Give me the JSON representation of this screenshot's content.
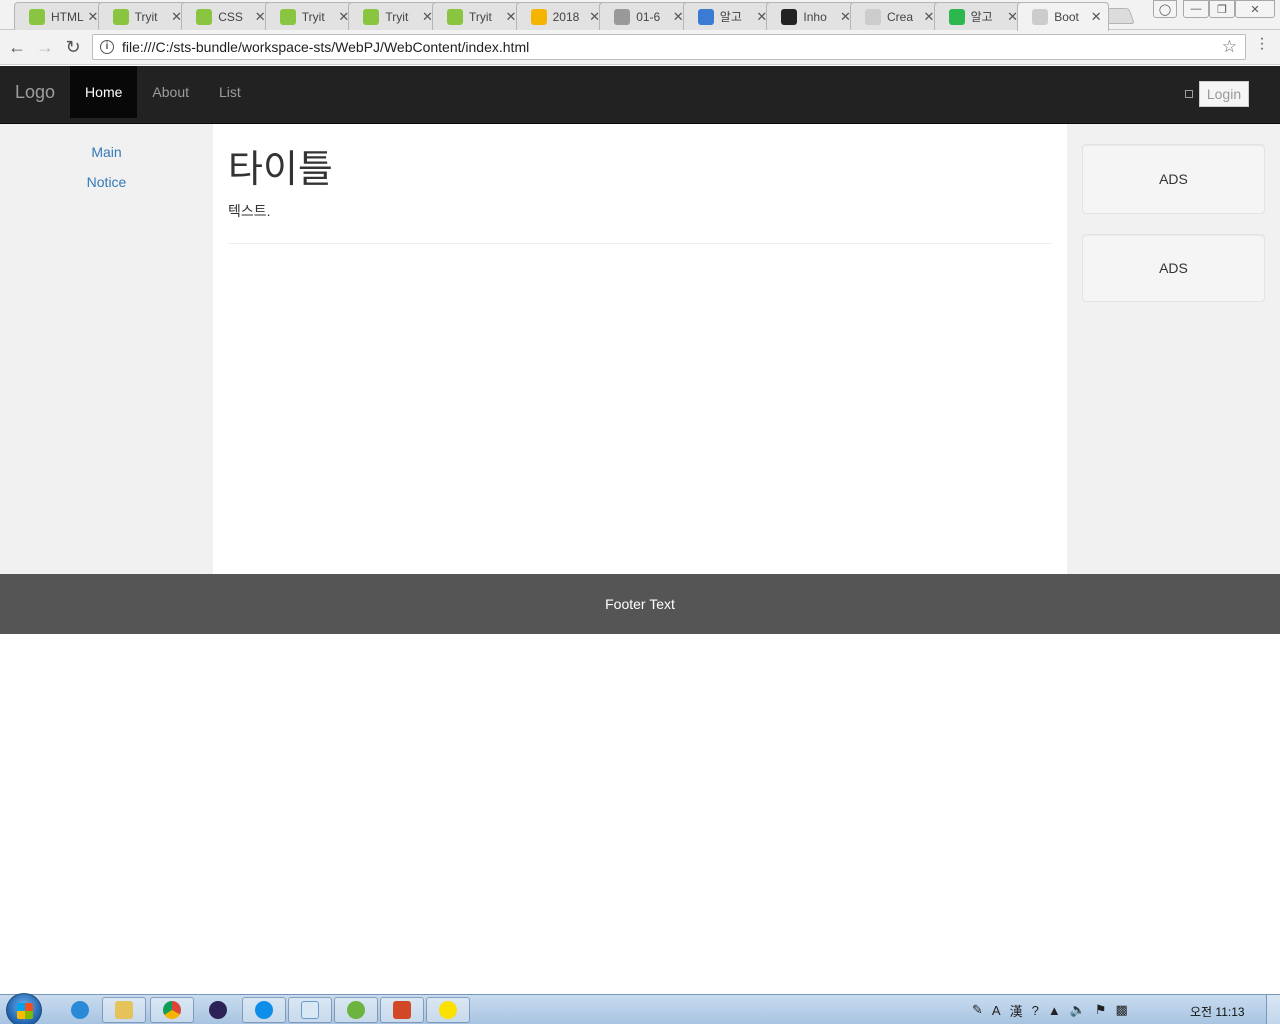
{
  "browser": {
    "tabs": [
      {
        "label": "HTML",
        "favicon": "w3schools-icon",
        "color": "#8ac542"
      },
      {
        "label": "Tryit",
        "favicon": "w3schools-icon",
        "color": "#8ac542"
      },
      {
        "label": "CSS",
        "favicon": "w3schools-icon",
        "color": "#8ac542"
      },
      {
        "label": "Tryit",
        "favicon": "w3schools-icon",
        "color": "#8ac542"
      },
      {
        "label": "Tryit",
        "favicon": "w3schools-icon",
        "color": "#8ac542"
      },
      {
        "label": "Tryit",
        "favicon": "w3schools-icon",
        "color": "#8ac542"
      },
      {
        "label": "2018",
        "favicon": "google-drive-icon",
        "color": "#f4b400"
      },
      {
        "label": "01-6",
        "favicon": "wikidocs-icon",
        "color": "#999999"
      },
      {
        "label": "알고",
        "favicon": "code-icon",
        "color": "#3b7bd4"
      },
      {
        "label": "Inho",
        "favicon": "github-icon",
        "color": "#222222"
      },
      {
        "label": "Crea",
        "favicon": "page-icon",
        "color": "#cccccc"
      },
      {
        "label": "알고",
        "favicon": "b-icon",
        "color": "#2db84d"
      },
      {
        "label": "Boot",
        "favicon": "page-icon",
        "color": "#cccccc",
        "active": true
      }
    ],
    "close_glyph": "✕",
    "url": "file:///C:/sts-bundle/workspace-sts/WebPJ/WebContent/index.html",
    "info_glyph": "i",
    "star_glyph": "☆",
    "menu_glyph": "⋮",
    "back_glyph": "←",
    "forward_glyph": "→",
    "reload_glyph": "↻",
    "window_buttons": [
      "user-icon",
      "minimize-icon",
      "restore-icon",
      "close-icon"
    ]
  },
  "site": {
    "brand": "Logo",
    "nav": [
      {
        "label": "Home",
        "active": true
      },
      {
        "label": "About"
      },
      {
        "label": "List"
      }
    ],
    "login_label": "Login",
    "sidebar_left": [
      "Main",
      "Notice"
    ],
    "main_title": "타이틀",
    "main_text": "텍스트.",
    "ads": [
      "ADS",
      "ADS"
    ],
    "footer_text": "Footer Text"
  },
  "taskbar": {
    "clock": "오전 11:13",
    "tray_text": [
      "A",
      "漢",
      "?"
    ]
  }
}
